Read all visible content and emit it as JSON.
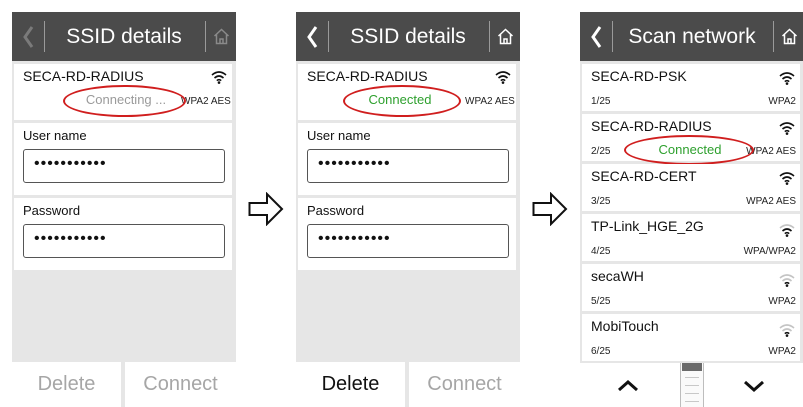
{
  "screen1": {
    "header": {
      "title": "SSID details"
    },
    "ssid": {
      "name": "SECA-RD-RADIUS",
      "status": "Connecting ...",
      "security": "WPA2 AES"
    },
    "username": {
      "label": "User name",
      "value": "•••••••••••"
    },
    "password": {
      "label": "Password",
      "value": "•••••••••••"
    },
    "buttons": {
      "delete": "Delete",
      "connect": "Connect"
    }
  },
  "screen2": {
    "header": {
      "title": "SSID details"
    },
    "ssid": {
      "name": "SECA-RD-RADIUS",
      "status": "Connected",
      "security": "WPA2 AES"
    },
    "username": {
      "label": "User name",
      "value": "•••••••••••"
    },
    "password": {
      "label": "Password",
      "value": "•••••••••••"
    },
    "buttons": {
      "delete": "Delete",
      "connect": "Connect"
    }
  },
  "screen3": {
    "header": {
      "title": "Scan network"
    },
    "networks": [
      {
        "name": "SECA-RD-PSK",
        "count": "1/25",
        "security": "WPA2",
        "status": "",
        "signal": 4
      },
      {
        "name": "SECA-RD-RADIUS",
        "count": "2/25",
        "security": "WPA2 AES",
        "status": "Connected",
        "signal": 4
      },
      {
        "name": "SECA-RD-CERT",
        "count": "3/25",
        "security": "WPA2 AES",
        "status": "",
        "signal": 4
      },
      {
        "name": "TP-Link_HGE_2G",
        "count": "4/25",
        "security": "WPA/WPA2",
        "status": "",
        "signal": 3
      },
      {
        "name": "secaWH",
        "count": "5/25",
        "security": "WPA2",
        "status": "",
        "signal": 2
      },
      {
        "name": "MobiTouch",
        "count": "6/25",
        "security": "WPA2",
        "status": "",
        "signal": 2
      }
    ],
    "scroll_position": 0.0
  },
  "icons": {
    "back": "chevron-left-icon",
    "home": "home-icon",
    "wifi": "wifi-icon",
    "flow_arrow": "right-arrow-icon",
    "page_up": "chevron-up-icon",
    "page_down": "chevron-down-icon"
  },
  "colors": {
    "header_bg": "#4b4b4b",
    "connected_text": "#2ea02e",
    "connecting_text": "#9a9a9a",
    "annotation_ring": "#d01e1e",
    "disabled_text": "#a6a6a6"
  }
}
